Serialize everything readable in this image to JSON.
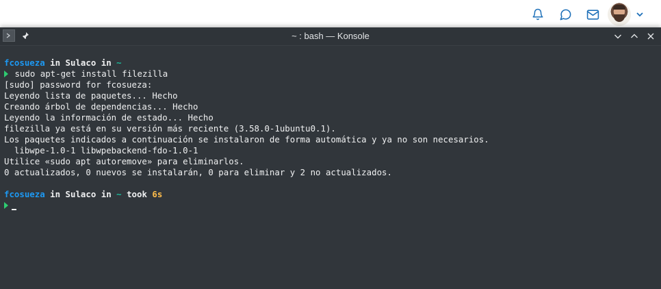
{
  "header": {
    "icons": [
      "bell-icon",
      "chat-bubble-icon",
      "mail-icon"
    ],
    "dropdown_icon": "chevron-down-icon"
  },
  "window": {
    "title": "~ : bash — Konsole",
    "controls": [
      "minimize",
      "maximize",
      "close"
    ]
  },
  "terminal": {
    "prompt1": {
      "user": "fcosueza",
      "in1": " in ",
      "host": "Sulaco",
      "in2": " in ",
      "dir": "~"
    },
    "command1": " sudo apt-get install filezilla",
    "output": [
      "[sudo] password for fcosueza:",
      "Leyendo lista de paquetes... Hecho",
      "Creando árbol de dependencias... Hecho",
      "Leyendo la información de estado... Hecho",
      "filezilla ya está en su versión más reciente (3.58.0-1ubuntu0.1).",
      "Los paquetes indicados a continuación se instalaron de forma automática y ya no son necesarios.",
      "  libwpe-1.0-1 libwpebackend-fdo-1.0-1",
      "Utilice «sudo apt autoremove» para eliminarlos.",
      "0 actualizados, 0 nuevos se instalarán, 0 para eliminar y 2 no actualizados."
    ],
    "prompt2": {
      "user": "fcosueza",
      "in1": " in ",
      "host": "Sulaco",
      "in2": " in ",
      "dir": "~",
      "took": " took ",
      "duration": "6s"
    }
  },
  "colors": {
    "terminal_bg": "#31363b",
    "user": "#1d99f3",
    "dir": "#1abc9c",
    "duration": "#fdbc4b",
    "prompt_arrow": "#2ecc71",
    "header_icon": "#1c6fb8"
  }
}
